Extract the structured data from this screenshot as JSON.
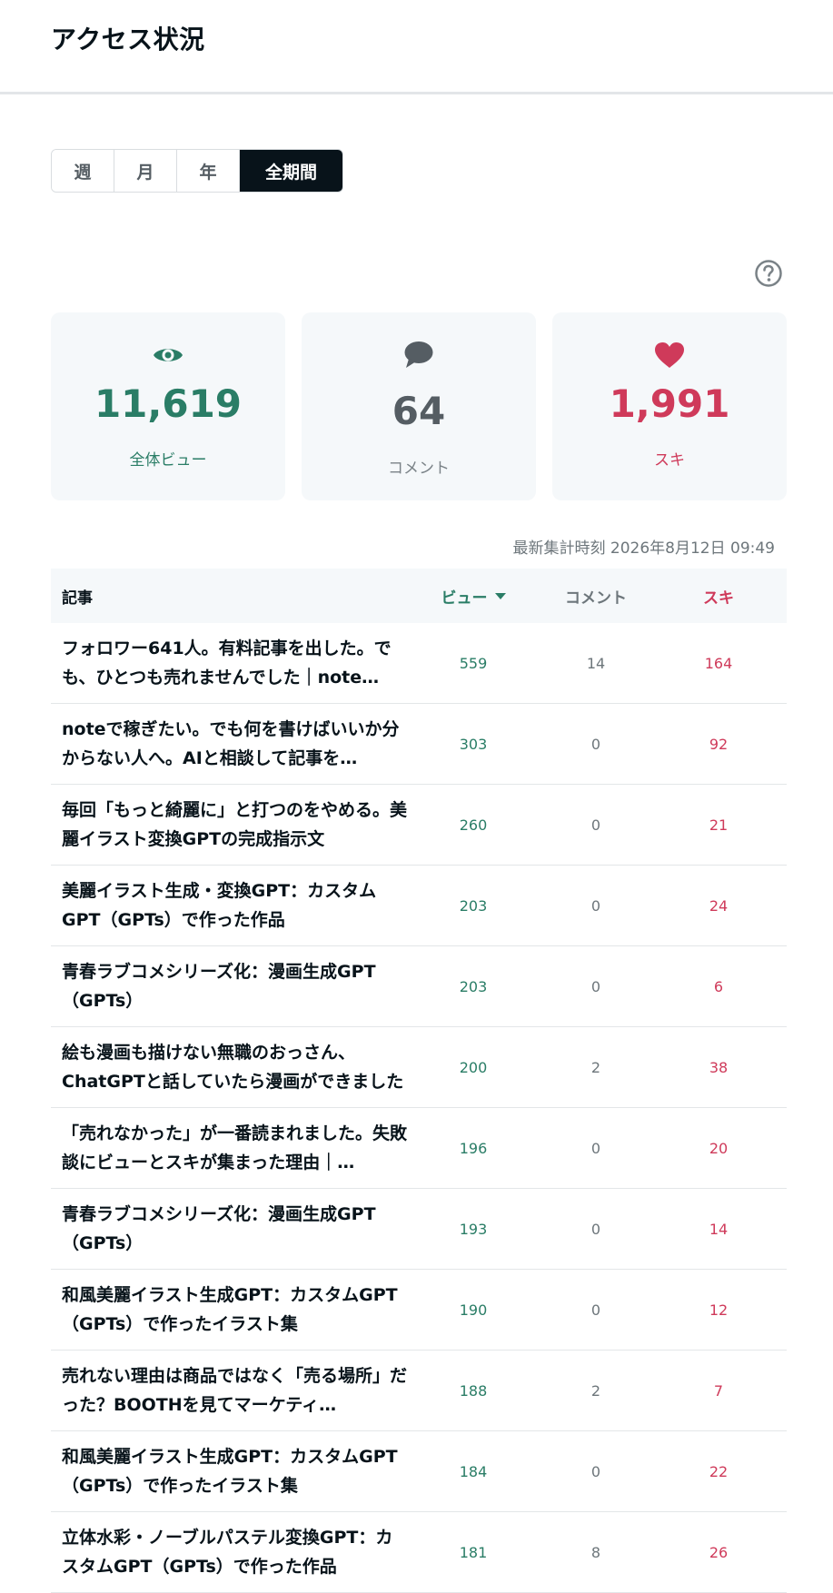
{
  "page": {
    "title": "アクセス状況"
  },
  "period_tabs": [
    {
      "label": "週",
      "active": false
    },
    {
      "label": "月",
      "active": false
    },
    {
      "label": "年",
      "active": false
    },
    {
      "label": "全期間",
      "active": true
    }
  ],
  "stats": {
    "views": {
      "value": "11,619",
      "label": "全体ビュー",
      "icon": "eye-icon",
      "color": "#2a7d66"
    },
    "comments": {
      "value": "64",
      "label": "コメント",
      "icon": "speech-bubble-icon",
      "color": "#555d63"
    },
    "likes": {
      "value": "1,991",
      "label": "スキ",
      "icon": "heart-icon",
      "color": "#cf3a5a"
    }
  },
  "timestamp": "最新集計時刻 2026年8月12日 09:49",
  "table": {
    "headers": {
      "title": "記事",
      "views": "ビュー",
      "comments": "コメント",
      "likes": "スキ"
    },
    "rows": [
      {
        "title": "フォロワー641人。有料記事を出した。でも、ひとつも売れませんでした｜note…",
        "views": "559",
        "comments": "14",
        "likes": "164"
      },
      {
        "title": "noteで稼ぎたい。でも何を書けばいいか分からない人へ。AIと相談して記事を…",
        "views": "303",
        "comments": "0",
        "likes": "92"
      },
      {
        "title": "毎回「もっと綺麗に」と打つのをやめる。美麗イラスト変換GPTの完成指示文",
        "views": "260",
        "comments": "0",
        "likes": "21"
      },
      {
        "title": "美麗イラスト生成・変換GPT：カスタムGPT（GPTs）で作った作品",
        "views": "203",
        "comments": "0",
        "likes": "24"
      },
      {
        "title": "青春ラブコメシリーズ化：漫画生成GPT（GPTs）",
        "views": "203",
        "comments": "0",
        "likes": "6"
      },
      {
        "title": "絵も漫画も描けない無職のおっさん、ChatGPTと話していたら漫画ができました",
        "views": "200",
        "comments": "2",
        "likes": "38"
      },
      {
        "title": "「売れなかった」が一番読まれました。失敗談にビューとスキが集まった理由｜…",
        "views": "196",
        "comments": "0",
        "likes": "20"
      },
      {
        "title": "青春ラブコメシリーズ化：漫画生成GPT（GPTs）",
        "views": "193",
        "comments": "0",
        "likes": "14"
      },
      {
        "title": "和風美麗イラスト生成GPT：カスタムGPT（GPTs）で作ったイラスト集",
        "views": "190",
        "comments": "0",
        "likes": "12"
      },
      {
        "title": "売れない理由は商品ではなく「売る場所」だった？BOOTHを見てマーケティ…",
        "views": "188",
        "comments": "2",
        "likes": "7"
      },
      {
        "title": "和風美麗イラスト生成GPT：カスタムGPT（GPTs）で作ったイラスト集",
        "views": "184",
        "comments": "0",
        "likes": "22"
      },
      {
        "title": "立体水彩・ノーブルパステル変換GPT：カスタムGPT（GPTs）で作った作品",
        "views": "181",
        "comments": "8",
        "likes": "26"
      }
    ]
  }
}
